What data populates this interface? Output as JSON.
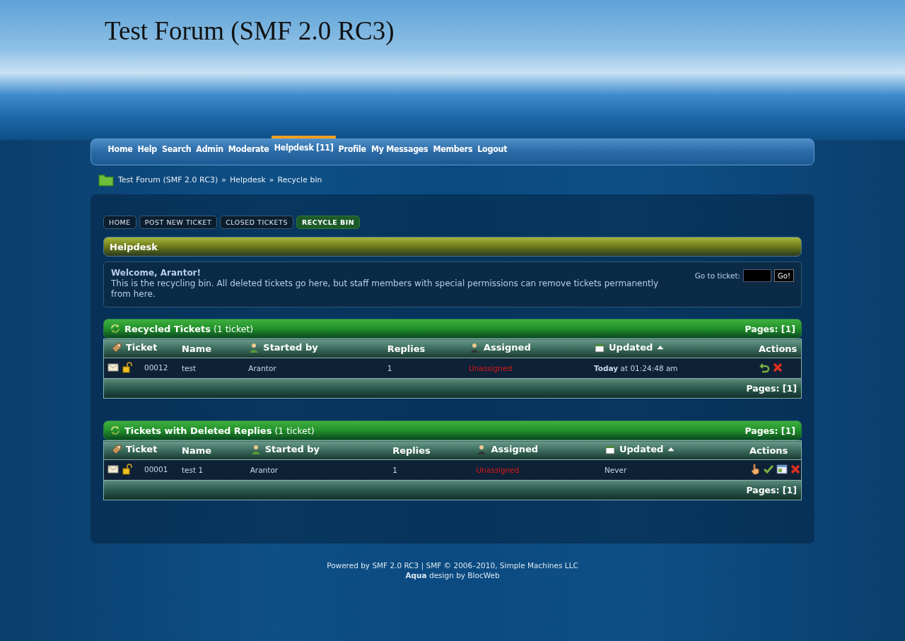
{
  "header": {
    "title": "Test Forum (SMF 2.0 RC3)"
  },
  "menu": [
    {
      "label": "Home",
      "selected": false
    },
    {
      "label": "Help",
      "selected": false
    },
    {
      "label": "Search",
      "selected": false
    },
    {
      "label": "Admin",
      "selected": false
    },
    {
      "label": "Moderate",
      "selected": false
    },
    {
      "label": "Helpdesk [11]",
      "selected": true
    },
    {
      "label": "Profile",
      "selected": false
    },
    {
      "label": "My Messages",
      "selected": false
    },
    {
      "label": "Members",
      "selected": false
    },
    {
      "label": "Logout",
      "selected": false
    }
  ],
  "breadcrumb": {
    "separator": "»",
    "items": [
      "Test Forum (SMF 2.0 RC3)",
      "Helpdesk",
      "Recycle bin"
    ]
  },
  "subtabs": [
    {
      "label": "HOME",
      "selected": false
    },
    {
      "label": "POST NEW TICKET",
      "selected": false
    },
    {
      "label": "CLOSED TICKETS",
      "selected": false
    },
    {
      "label": "RECYCLE BIN",
      "selected": true
    }
  ],
  "helpdesk": {
    "title": "Helpdesk",
    "welcome": "Welcome, Arantor!",
    "intro": "This is the recycling bin. All deleted tickets go here, but staff members with special permissions can remove tickets permanently from here.",
    "goto_label": "Go to ticket:",
    "go_button": "Go!"
  },
  "tables": [
    {
      "title": "Recycled Tickets",
      "count": "(1 ticket)",
      "pages_top": "Pages: [1]",
      "pages_bottom": "Pages: [1]",
      "columns": [
        {
          "kind": "ticket",
          "label": "Ticket"
        },
        {
          "kind": "name",
          "label": "Name"
        },
        {
          "kind": "starter",
          "label": "Started by"
        },
        {
          "kind": "replies",
          "label": "Replies"
        },
        {
          "kind": "assigned",
          "label": "Assigned"
        },
        {
          "kind": "updated",
          "label": "Updated",
          "sorted": true
        },
        {
          "kind": "actions",
          "label": "Actions"
        }
      ],
      "rows": [
        {
          "id": "00012",
          "name": "test",
          "starter": "Arantor",
          "replies": "1",
          "assigned": "Unassigned",
          "updated": "**Today** at 01:24:48 am",
          "actions": [
            {
              "kind": "restore"
            },
            {
              "kind": "delete"
            }
          ]
        }
      ]
    },
    {
      "title": "Tickets with Deleted Replies",
      "count": "(1 ticket)",
      "pages_top": "Pages: [1]",
      "pages_bottom": "Pages: [1]",
      "columns": [
        {
          "kind": "ticket",
          "label": "Ticket"
        },
        {
          "kind": "name",
          "label": "Name"
        },
        {
          "kind": "starter",
          "label": "Started by"
        },
        {
          "kind": "replies",
          "label": "Replies"
        },
        {
          "kind": "assigned",
          "label": "Assigned"
        },
        {
          "kind": "updated",
          "label": "Updated",
          "sorted": true
        },
        {
          "kind": "actions",
          "label": "Actions"
        }
      ],
      "rows": [
        {
          "id": "00001",
          "name": "test 1",
          "starter": "Arantor",
          "replies": "1",
          "assigned": "Unassigned",
          "updated": "Never",
          "actions": [
            {
              "kind": "take"
            },
            {
              "kind": "approve"
            },
            {
              "kind": "view"
            },
            {
              "kind": "delete"
            }
          ]
        }
      ]
    }
  ],
  "footer": {
    "powered": "Powered by SMF 2.0 RC3 | SMF © 2006–2010, Simple Machines LLC",
    "design": "**Aqua** design by BlocWeb"
  }
}
